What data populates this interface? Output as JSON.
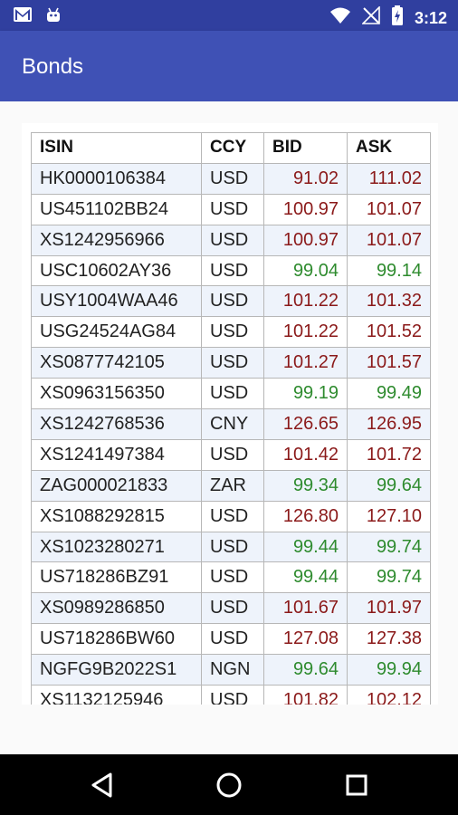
{
  "status_bar": {
    "time": "3:12",
    "icons": [
      "gmail-icon",
      "android-icon",
      "wifi-icon",
      "no-signal-icon",
      "battery-charging-icon"
    ]
  },
  "app_bar": {
    "title": "Bonds"
  },
  "table": {
    "headers": [
      "ISIN",
      "CCY",
      "BID",
      "ASK"
    ],
    "rows": [
      {
        "isin": "HK0000106384",
        "ccy": "USD",
        "bid": "91.02",
        "ask": "111.02",
        "color": "#8b1a1a"
      },
      {
        "isin": "US451102BB24",
        "ccy": "USD",
        "bid": "100.97",
        "ask": "101.07",
        "color": "#8b1a1a"
      },
      {
        "isin": "XS1242956966",
        "ccy": "USD",
        "bid": "100.97",
        "ask": "101.07",
        "color": "#8b1a1a"
      },
      {
        "isin": "USC10602AY36",
        "ccy": "USD",
        "bid": "99.04",
        "ask": "99.14",
        "color": "#2e8b2e"
      },
      {
        "isin": "USY1004WAA46",
        "ccy": "USD",
        "bid": "101.22",
        "ask": "101.32",
        "color": "#8b1a1a"
      },
      {
        "isin": "USG24524AG84",
        "ccy": "USD",
        "bid": "101.22",
        "ask": "101.52",
        "color": "#8b1a1a"
      },
      {
        "isin": "XS0877742105",
        "ccy": "USD",
        "bid": "101.27",
        "ask": "101.57",
        "color": "#8b1a1a"
      },
      {
        "isin": "XS0963156350",
        "ccy": "USD",
        "bid": "99.19",
        "ask": "99.49",
        "color": "#2e8b2e"
      },
      {
        "isin": "XS1242768536",
        "ccy": "CNY",
        "bid": "126.65",
        "ask": "126.95",
        "color": "#8b1a1a"
      },
      {
        "isin": "XS1241497384",
        "ccy": "USD",
        "bid": "101.42",
        "ask": "101.72",
        "color": "#8b1a1a"
      },
      {
        "isin": "ZAG000021833",
        "ccy": "ZAR",
        "bid": "99.34",
        "ask": "99.64",
        "color": "#2e8b2e"
      },
      {
        "isin": "XS1088292815",
        "ccy": "USD",
        "bid": "126.80",
        "ask": "127.10",
        "color": "#8b1a1a"
      },
      {
        "isin": "XS1023280271",
        "ccy": "USD",
        "bid": "99.44",
        "ask": "99.74",
        "color": "#2e8b2e"
      },
      {
        "isin": "US718286BZ91",
        "ccy": "USD",
        "bid": "99.44",
        "ask": "99.74",
        "color": "#2e8b2e"
      },
      {
        "isin": "XS0989286850",
        "ccy": "USD",
        "bid": "101.67",
        "ask": "101.97",
        "color": "#8b1a1a"
      },
      {
        "isin": "US718286BW60",
        "ccy": "USD",
        "bid": "127.08",
        "ask": "127.38",
        "color": "#8b1a1a"
      },
      {
        "isin": "NGFG9B2022S1",
        "ccy": "NGN",
        "bid": "99.64",
        "ask": "99.94",
        "color": "#2e8b2e"
      },
      {
        "isin": "XS1132125946",
        "ccy": "USD",
        "bid": "101.82",
        "ask": "102.12",
        "color": "#8b1a1a"
      }
    ]
  },
  "nav_bar": {
    "buttons": [
      "back-icon",
      "home-icon",
      "recents-icon"
    ]
  }
}
